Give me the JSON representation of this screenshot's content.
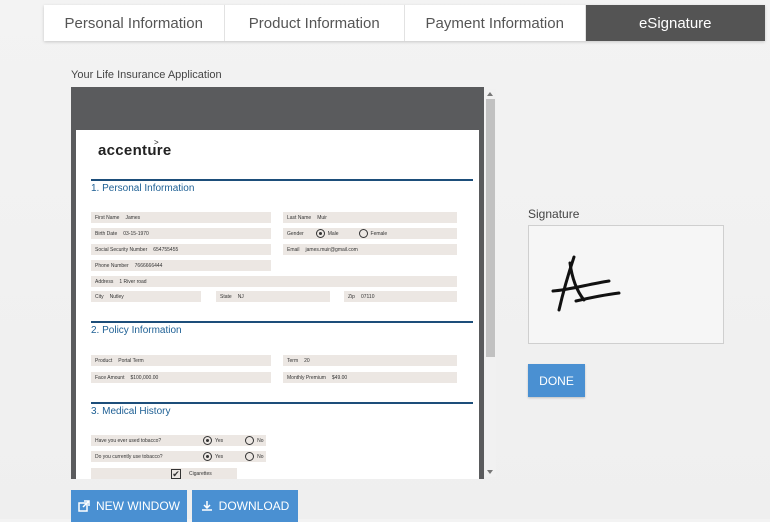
{
  "tabs": [
    {
      "label": "Personal Information",
      "active": false
    },
    {
      "label": "Product Information",
      "active": false
    },
    {
      "label": "Payment Information",
      "active": false
    },
    {
      "label": "eSignature",
      "active": true
    }
  ],
  "app_title": "Your Life Insurance Application",
  "document": {
    "logo": "accenture",
    "sections": {
      "personal": "1. Personal Information",
      "policy": "2. Policy Information",
      "medical": "3. Medical History"
    },
    "personal": {
      "first_name_label": "First Name",
      "first_name": "James",
      "last_name_label": "Last Name",
      "last_name": "Muir",
      "birth_date_label": "Birth Date",
      "birth_date": "03-15-1970",
      "gender_label": "Gender",
      "gender_male": "Male",
      "gender_female": "Female",
      "ssn_label": "Social Security Number",
      "ssn": "654755455",
      "email_label": "Email",
      "email": "james.muir@gmail.com",
      "phone_label": "Phone Number",
      "phone": "7666666444",
      "address_label": "Address",
      "address": "1 River road",
      "city_label": "City",
      "city": "Nutley",
      "state_label": "State",
      "state": "NJ",
      "zip_label": "Zip",
      "zip": "07110"
    },
    "policy": {
      "product_label": "Product",
      "product": "Portal Term",
      "term_label": "Term",
      "term": "20",
      "face_label": "Face Amount",
      "face": "$100,000.00",
      "premium_label": "Monthly Premium",
      "premium": "$49.00"
    },
    "medical": {
      "q1": "Have you ever used tobacco?",
      "q2": "Do you currently use tobacco?",
      "yes": "Yes",
      "no": "No",
      "cigarettes": "Cigarettes"
    }
  },
  "signature": {
    "label": "Signature",
    "done_label": "DONE"
  },
  "actions": {
    "new_window": "NEW WINDOW",
    "download": "DOWNLOAD"
  },
  "colors": {
    "accent": "#4a90d2",
    "active_tab": "#545454",
    "section": "#1d4e7a"
  }
}
